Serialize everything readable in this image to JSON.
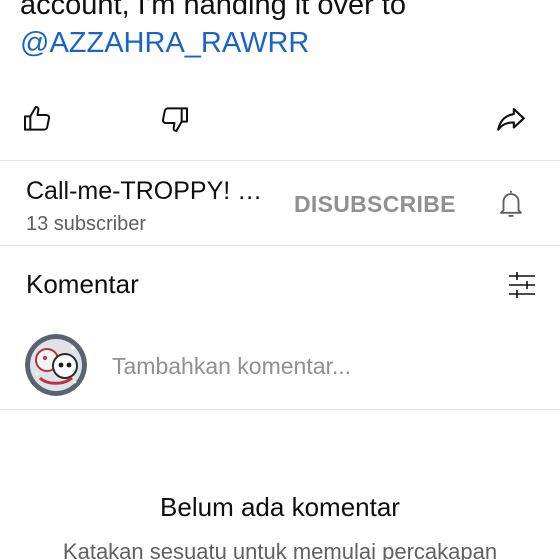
{
  "description": {
    "line1": "account, I'm handing it over to",
    "mention": "@AZZAHRA_RAWRR"
  },
  "actions": {
    "like_icon": "thumbs-up-icon",
    "dislike_icon": "thumbs-down-icon",
    "share_icon": "share-icon"
  },
  "channel": {
    "name": "Call-me-TROPPY! …",
    "subscribers": "13 subscriber",
    "unsubscribe_label": "DISUBSCRIBE",
    "bell_icon": "bell-icon"
  },
  "comments": {
    "title": "Komentar",
    "sort_icon": "sliders-icon",
    "input_placeholder": "Tambahkan komentar...",
    "empty_title": "Belum ada komentar",
    "empty_subtitle": "Katakan sesuatu untuk memulai percakapan"
  },
  "colors": {
    "link": "#1a64c5",
    "text": "#0f0f0f",
    "secondary_text": "#606060",
    "muted_button": "#909090",
    "divider": "#e5e5e5"
  }
}
